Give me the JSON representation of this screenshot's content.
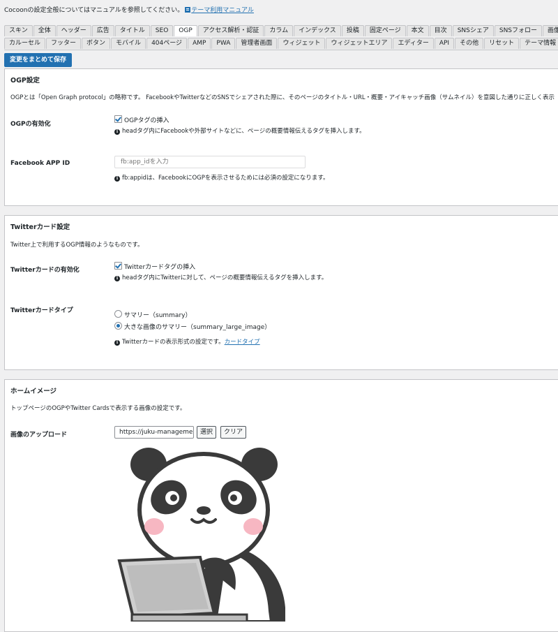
{
  "intro": {
    "text": "Cocoonの設定全般についてはマニュアルを参照してください。",
    "link_label": "テーマ利用マニュアル"
  },
  "tabs_row1": [
    "スキン",
    "全体",
    "ヘッダー",
    "広告",
    "タイトル",
    "SEO",
    "OGP",
    "アクセス解析・認証",
    "カラム",
    "インデックス",
    "投稿",
    "固定ページ",
    "本文",
    "目次",
    "SNSシェア",
    "SNSフォロー",
    "画像"
  ],
  "tabs_row2": [
    "カルーセル",
    "フッター",
    "ボタン",
    "モバイル",
    "404ページ",
    "AMP",
    "PWA",
    "管理者画面",
    "ウィジェット",
    "ウィジェットエリア",
    "エディター",
    "API",
    "その他",
    "リセット",
    "テーマ情報"
  ],
  "active_tab": "OGP",
  "save_button": "変更をまとめて保存",
  "ogp": {
    "title": "OGP設定",
    "description": "OGPとは「Open Graph protocol」の略称です。 FacebookやTwitterなどのSNSでシェアされた際に、そのページのタイトル・URL・概要・アイキャッチ画像（サムネイル）を意図した通りに正しく表示",
    "enable_label": "OGPの有効化",
    "enable_checkbox": "OGPタグの挿入",
    "enable_tip": "headタグ内にFacebookや外部サイトなどに、ページの概要情報伝えるタグを挿入します。",
    "appid_label": "Facebook APP ID",
    "appid_placeholder": "fb:app_idを入力",
    "appid_tip": "fb:appidは、FacebookにOGPを表示させるためには必須の設定になります。"
  },
  "twitter": {
    "title": "Twitterカード設定",
    "description": "Twitter上で利用するOGP情報のようなものです。",
    "enable_label": "Twitterカードの有効化",
    "enable_checkbox": "Twitterカードタグの挿入",
    "enable_tip": "headタグ内にTwitterに対して、ページの概要情報伝えるタグを挿入します。",
    "type_label": "Twitterカードタイプ",
    "option_summary": "サマリー（summary）",
    "option_large": "大きな画像のサマリー（summary_large_image）",
    "type_tip": "Twitterカードの表示形式の設定です。",
    "type_link": "カードタイプ"
  },
  "home_image": {
    "title": "ホームイメージ",
    "description": "トップページのOGPやTwitter Cardsで表示する画像の設定です。",
    "upload_label": "画像のアップロード",
    "url_value": "https://juku-management",
    "select_button": "選択",
    "clear_button": "クリア"
  },
  "colors": {
    "accent": "#2271b1",
    "background": "#f0f0f1",
    "panel": "#ffffff",
    "border": "#c3c4c7"
  }
}
